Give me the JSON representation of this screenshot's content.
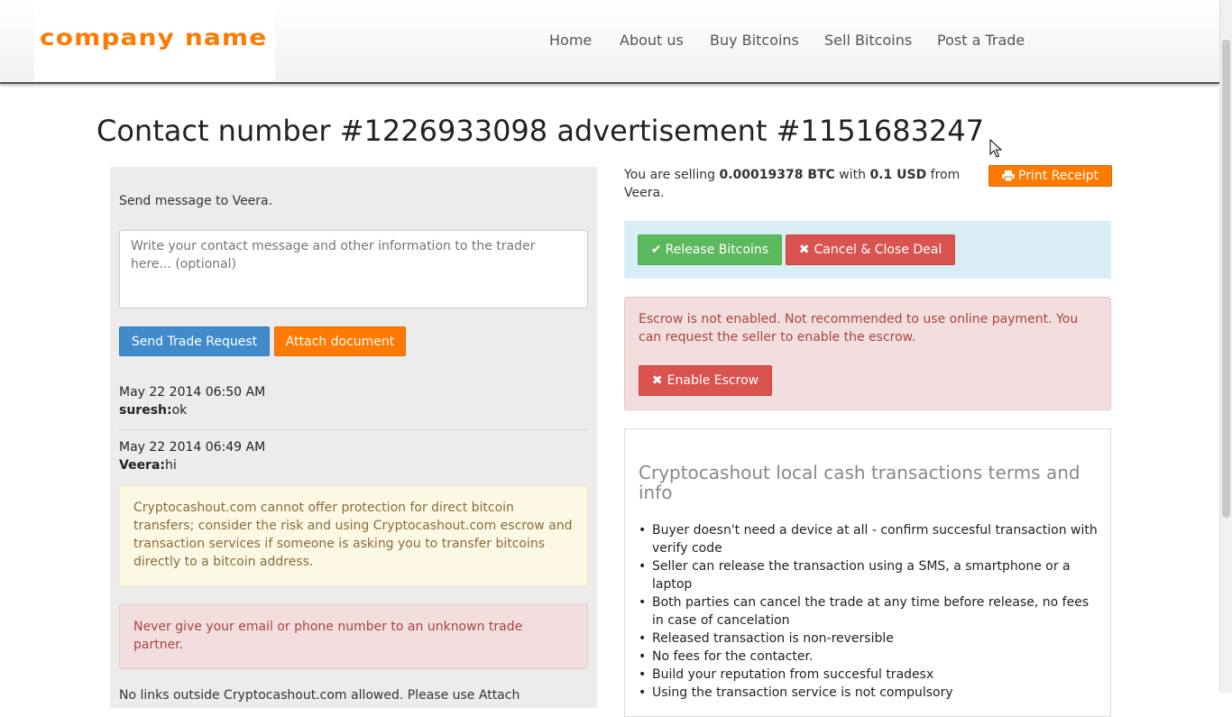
{
  "navbar": {
    "logo": "company name",
    "items": [
      "Home",
      "About us",
      "Buy Bitcoins",
      "Sell Bitcoins",
      "Post a Trade"
    ]
  },
  "page": {
    "title": "Contact number #1226933098 advertisement #1151683247"
  },
  "chat": {
    "label": "Send message to Veera.",
    "placeholder": "Write your contact message and other information to the trader here... (optional)",
    "send_button": "Send Trade Request",
    "attach_button": "Attach document",
    "messages": [
      {
        "time": "May 22 2014 06:50 AM",
        "author": "suresh:",
        "text": "ok"
      },
      {
        "time": "May 22 2014 06:49 AM",
        "author": "Veera:",
        "text": "hi"
      }
    ],
    "warning": "Cryptocashout.com cannot offer protection for direct bitcoin transfers; consider the risk and using Cryptocashout.com escrow and transaction services if someone is asking you to transfer bitcoins directly to a bitcoin address.",
    "danger": "Never give your email or phone number to an unknown trade partner.",
    "cutoff": "No links outside Cryptocashout.com allowed. Please use Attach"
  },
  "deal": {
    "selling_prefix": "You are selling ",
    "btc_amount": "0.00019378 BTC",
    "with": " with ",
    "usd_amount": "0.1 USD",
    "from": " from Veera.",
    "print_button": "Print Receipt",
    "release_button": "Release Bitcoins",
    "cancel_button": "Cancel & Close Deal",
    "escrow_text": "Escrow is not enabled. Not recommended to use online payment. You can request the seller to enable the escrow.",
    "enable_escrow_button": "Enable Escrow"
  },
  "terms": {
    "title": "Cryptocashout local cash transactions terms and info",
    "items": [
      "Buyer doesn't need a device at all - confirm succesful transaction with verify code",
      "Seller can release the transaction using a SMS, a smartphone or a laptop",
      "Both parties can cancel the trade at any time before release, no fees in case of cancelation",
      "Released transaction is non-reversible",
      "No fees for the contacter.",
      "Build your reputation from succesful tradesx",
      "Using the transaction service is not compulsory"
    ]
  },
  "colors": {
    "brand_orange": "#ff7a00",
    "primary_blue": "#428bca",
    "success_green": "#5cb85c",
    "danger_red": "#d9534f"
  }
}
